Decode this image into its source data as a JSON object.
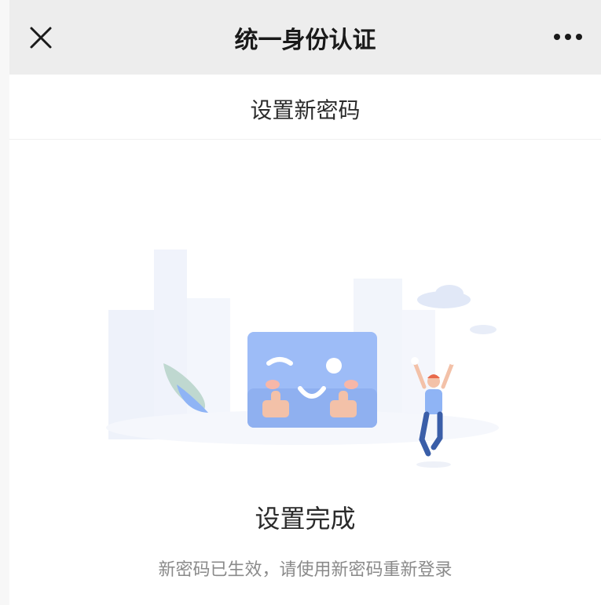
{
  "nav": {
    "title": "统一身份认证",
    "close_icon": "close-icon",
    "more_icon": "more-icon"
  },
  "subheader": {
    "title": "设置新密码"
  },
  "result": {
    "title": "设置完成",
    "description": "新密码已生效，请使用新密码重新登录"
  },
  "illustration": {
    "name": "success-illustration",
    "accent_color": "#8fb4f5",
    "card_color": "#9dbcf7"
  }
}
